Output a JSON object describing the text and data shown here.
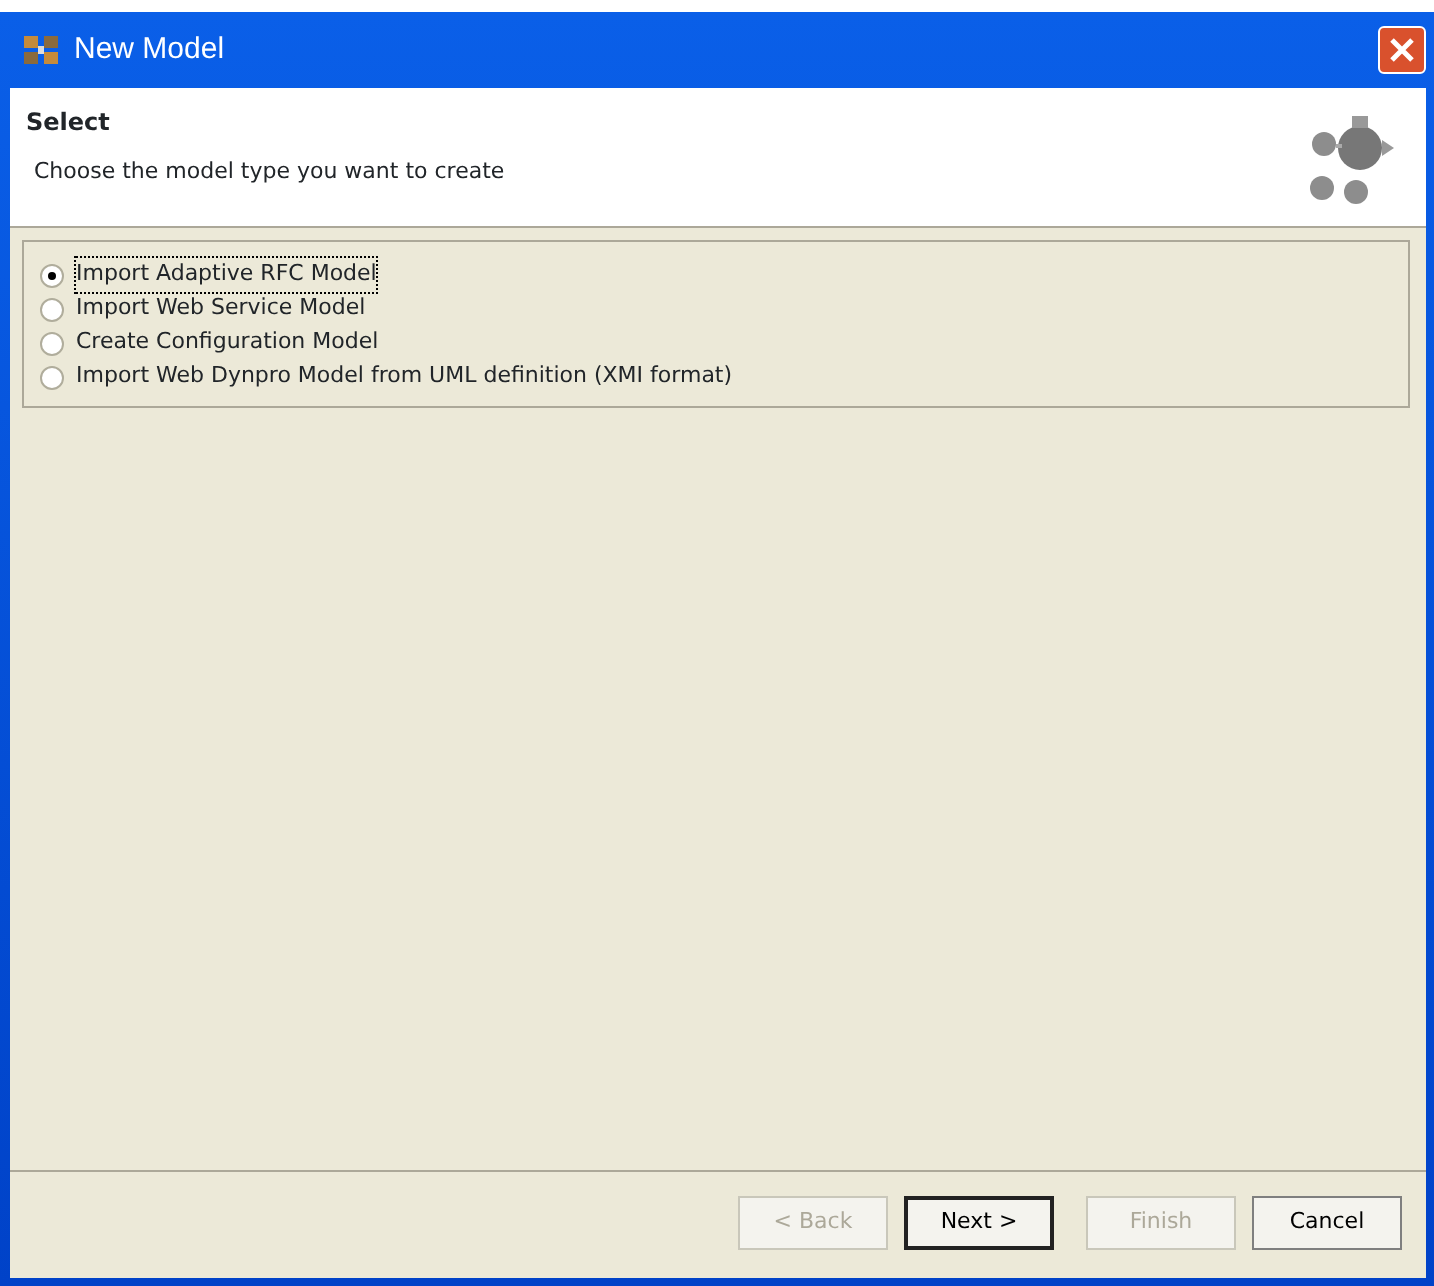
{
  "window": {
    "title": "New Model"
  },
  "header": {
    "title": "Select",
    "description": "Choose the model type you want to create"
  },
  "options": [
    {
      "label": "Import Adaptive RFC Model",
      "selected": true
    },
    {
      "label": "Import Web Service Model",
      "selected": false
    },
    {
      "label": "Create Configuration Model",
      "selected": false
    },
    {
      "label": "Import Web Dynpro Model from UML definition (XMI format)",
      "selected": false
    }
  ],
  "buttons": [
    {
      "label": "< Back",
      "disabled": true,
      "default": false
    },
    {
      "label": "Next >",
      "disabled": false,
      "default": true
    },
    {
      "label": "Finish",
      "disabled": true,
      "default": false
    },
    {
      "label": "Cancel",
      "disabled": false,
      "default": false
    }
  ]
}
